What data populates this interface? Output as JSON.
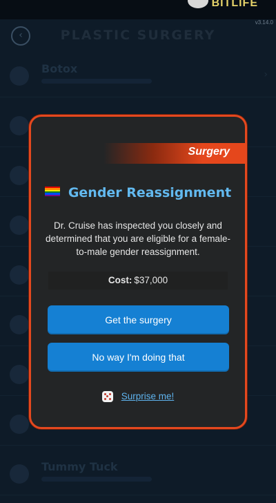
{
  "background": {
    "logo": "BITLIFE",
    "version": "v3.14.0",
    "title": "PLASTIC SURGERY",
    "rows": [
      {
        "name": "Botox"
      },
      {
        "name": ""
      },
      {
        "name": ""
      },
      {
        "name": ""
      },
      {
        "name": ""
      },
      {
        "name": ""
      },
      {
        "name": ""
      },
      {
        "name": ""
      },
      {
        "name": "Tummy Tuck"
      }
    ]
  },
  "modal": {
    "category": "Surgery",
    "title": "Gender Reassignment",
    "description": "Dr. Cruise has inspected you closely and determined that you are eligible for a female-to-male gender reassignment.",
    "cost_label": "Cost:",
    "cost_value": "$37,000",
    "primary_button": "Get the surgery",
    "secondary_button": "No way I'm doing that",
    "surprise_link": "Surprise me!",
    "flag_colors": [
      "#e40303",
      "#ff8c00",
      "#ffed00",
      "#008026",
      "#004dff",
      "#750787"
    ],
    "accent": "#e5471c",
    "button_color": "#1580d3"
  }
}
